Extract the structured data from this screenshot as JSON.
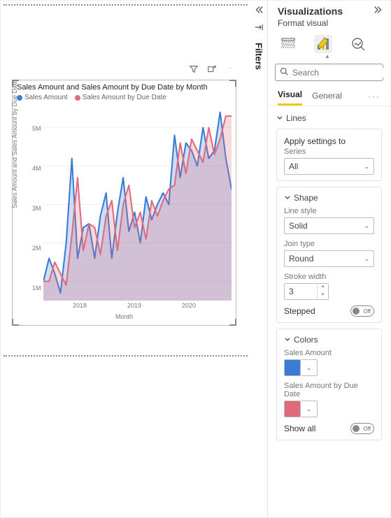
{
  "chart_data": {
    "type": "line",
    "title": "Sales Amount and Sales Amount by Due Date by Month",
    "xlabel": "Month",
    "ylabel": "Sales Amount and Sales Amount by Due Date",
    "ylim": [
      500000,
      5500000
    ],
    "yticks": [
      1000000,
      2000000,
      3000000,
      4000000,
      5000000
    ],
    "ytick_labels": [
      "1M",
      "2M",
      "3M",
      "4M",
      "5M"
    ],
    "xtick_labels": [
      "2018",
      "2019",
      "2020"
    ],
    "xtick_positions": [
      0.2,
      0.5,
      0.8
    ],
    "series": [
      {
        "name": "Sales Amount",
        "color": "#3a7bd5",
        "values": [
          1000000,
          1600000,
          1200000,
          700000,
          2000000,
          4200000,
          1600000,
          2400000,
          2500000,
          1600000,
          2700000,
          3300000,
          1600000,
          2800000,
          3700000,
          2300000,
          2800000,
          2000000,
          3200000,
          2600000,
          3000000,
          3300000,
          3000000,
          4800000,
          3700000,
          4600000,
          4400000,
          4000000,
          5000000,
          4200000,
          4400000,
          5400000,
          4200000,
          3400000
        ]
      },
      {
        "name": "Sales Amount by Due Date",
        "color": "#e06b7d",
        "values": [
          1000000,
          1000000,
          1500000,
          1200000,
          900000,
          2200000,
          3700000,
          1800000,
          2500000,
          2400000,
          1700000,
          2700000,
          3100000,
          1800000,
          3000000,
          3500000,
          2400000,
          2800000,
          2100000,
          3100000,
          2700000,
          3100000,
          3400000,
          3500000,
          4600000,
          3800000,
          4700000,
          4400000,
          4100000,
          5000000,
          4300000,
          4700000,
          5300000,
          5300000
        ]
      }
    ]
  },
  "filters_label": "Filters",
  "toolbar": {
    "filter": "filter",
    "focus": "focus",
    "more": "more"
  },
  "right_pane": {
    "title": "Visualizations",
    "subtitle": "Format visual",
    "search_placeholder": "Search",
    "tabs": {
      "visual": "Visual",
      "general": "General"
    },
    "sections": {
      "lines": "Lines",
      "apply_settings": "Apply settings to",
      "series_label": "Series",
      "series_value": "All",
      "shape": "Shape",
      "line_style_label": "Line style",
      "line_style_value": "Solid",
      "join_type_label": "Join type",
      "join_type_value": "Round",
      "stroke_width_label": "Stroke width",
      "stroke_width_value": "3",
      "stepped_label": "Stepped",
      "stepped_value": "Off",
      "colors": "Colors",
      "series1_label": "Sales Amount",
      "series1_color": "#3a7bd5",
      "series2_label": "Sales Amount by Due Date",
      "series2_color": "#e06b7d",
      "show_all_label": "Show all",
      "show_all_value": "Off"
    }
  }
}
